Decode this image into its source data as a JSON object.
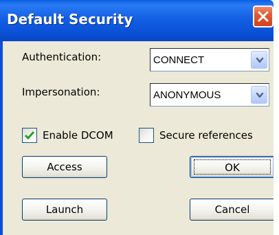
{
  "window": {
    "title": "Default Security"
  },
  "icons": {
    "close": "close-icon",
    "dropdown": "chevron-down-icon",
    "check": "checkmark-icon"
  },
  "fields": {
    "authentication": {
      "label": "Authentication:",
      "value": "CONNECT"
    },
    "impersonation": {
      "label": "Impersonation:",
      "value": "ANONYMOUS"
    }
  },
  "checkboxes": {
    "enable_dcom": {
      "label": "Enable DCOM",
      "checked": true
    },
    "secure_references": {
      "label": "Secure references",
      "checked": false
    }
  },
  "buttons": {
    "access": "Access",
    "ok": "OK",
    "launch": "Launch",
    "cancel": "Cancel"
  },
  "colors": {
    "titlebar": "#0a50d6",
    "client_bg": "#ece9d8",
    "close_button": "#e45a34",
    "check_green": "#21a121"
  }
}
